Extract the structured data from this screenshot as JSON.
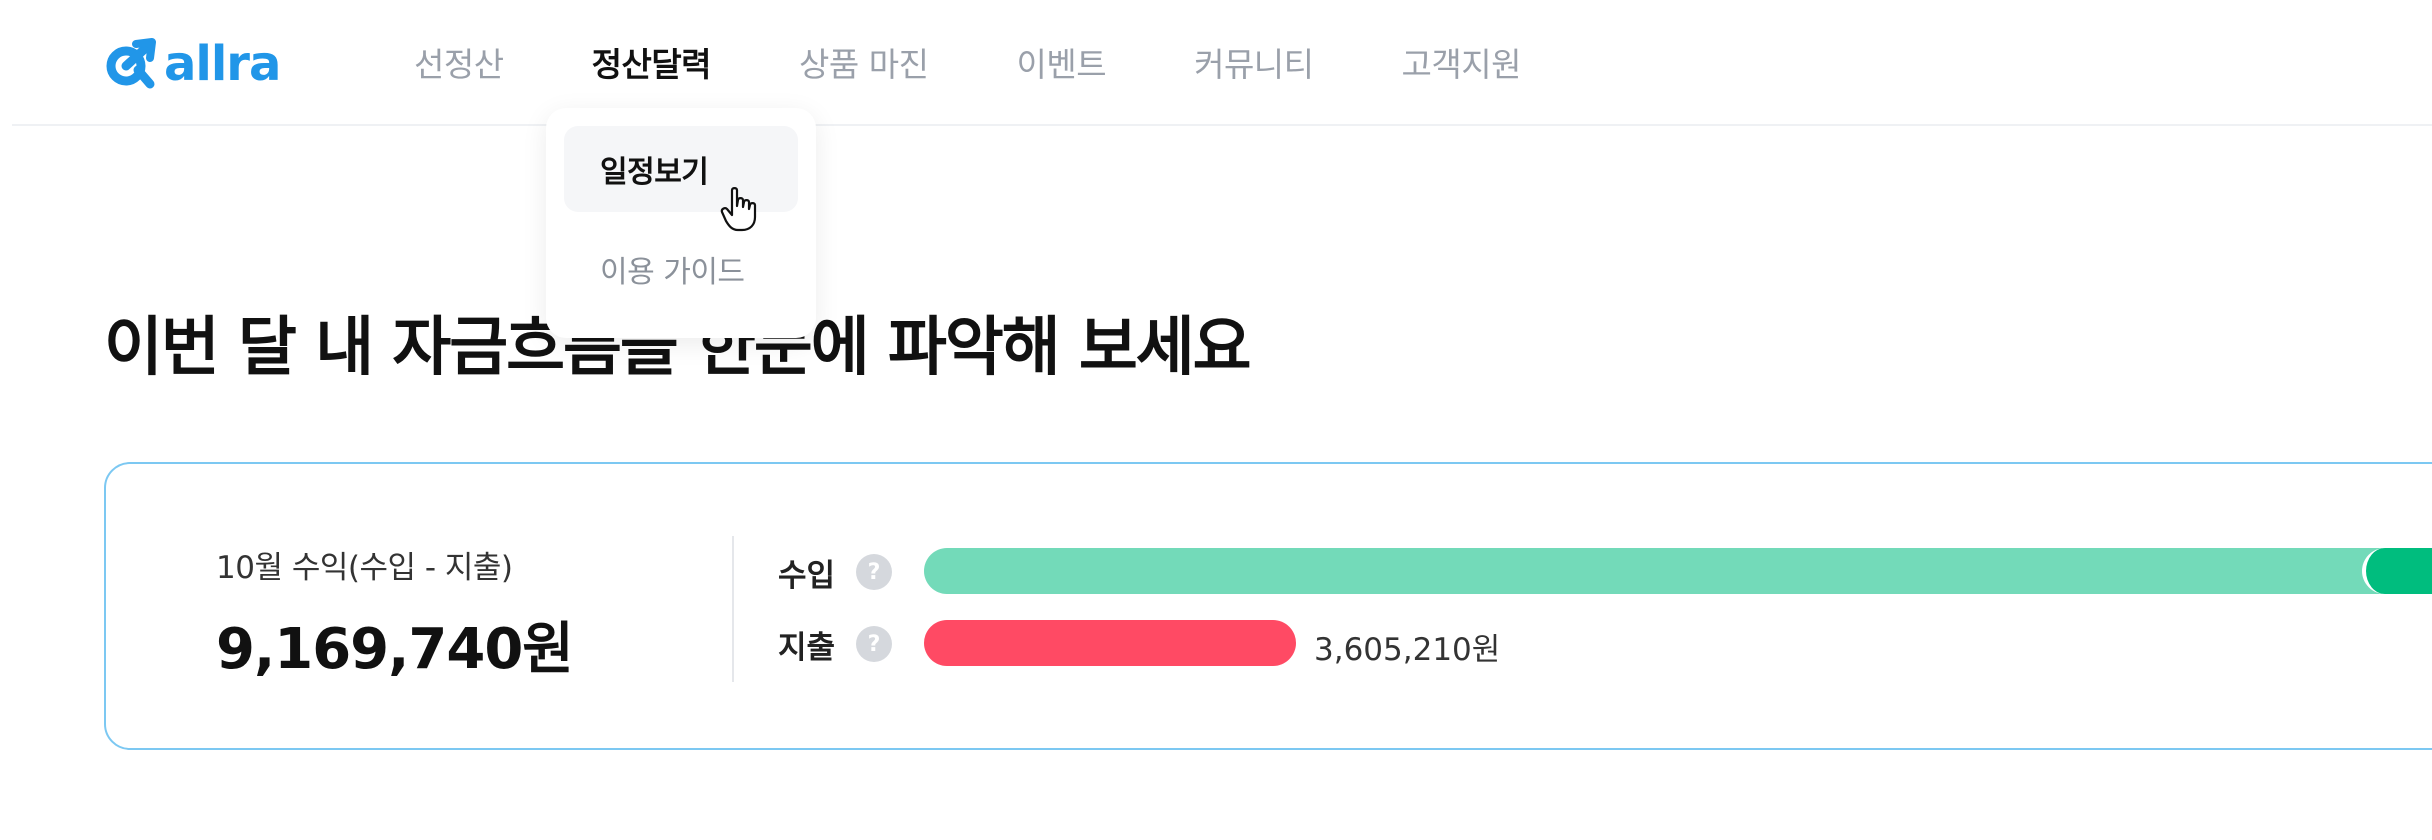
{
  "header": {
    "logo_text": "allra",
    "nav": [
      {
        "label": "선정산",
        "active": false
      },
      {
        "label": "정산달력",
        "active": true
      },
      {
        "label": "상품 마진",
        "active": false
      },
      {
        "label": "이벤트",
        "active": false
      },
      {
        "label": "커뮤니티",
        "active": false
      },
      {
        "label": "고객지원",
        "active": false
      }
    ],
    "dropdown": [
      {
        "label": "일정보기",
        "hovered": true
      },
      {
        "label": "이용 가이드",
        "hovered": false
      }
    ]
  },
  "main": {
    "headline": "이번 달 내 자금흐름을 한눈에 파악해 보세요",
    "summary": {
      "profit_label": "10월 수익(수입 - 지출)",
      "profit_value": "9,169,740원",
      "income_label": "수입",
      "expense_label": "지출",
      "help_symbol": "?",
      "expense_amount": "3,605,210원"
    }
  },
  "colors": {
    "brand": "#2196e8",
    "income_bar": "#73dab9",
    "income_bar_dark": "#00bd7e",
    "expense_bar": "#ff4a64",
    "card_border": "#7cc8f2"
  },
  "icons": {
    "logo": "allra-logo-icon",
    "help": "question-circle-icon",
    "cursor": "hand-pointer-icon"
  }
}
